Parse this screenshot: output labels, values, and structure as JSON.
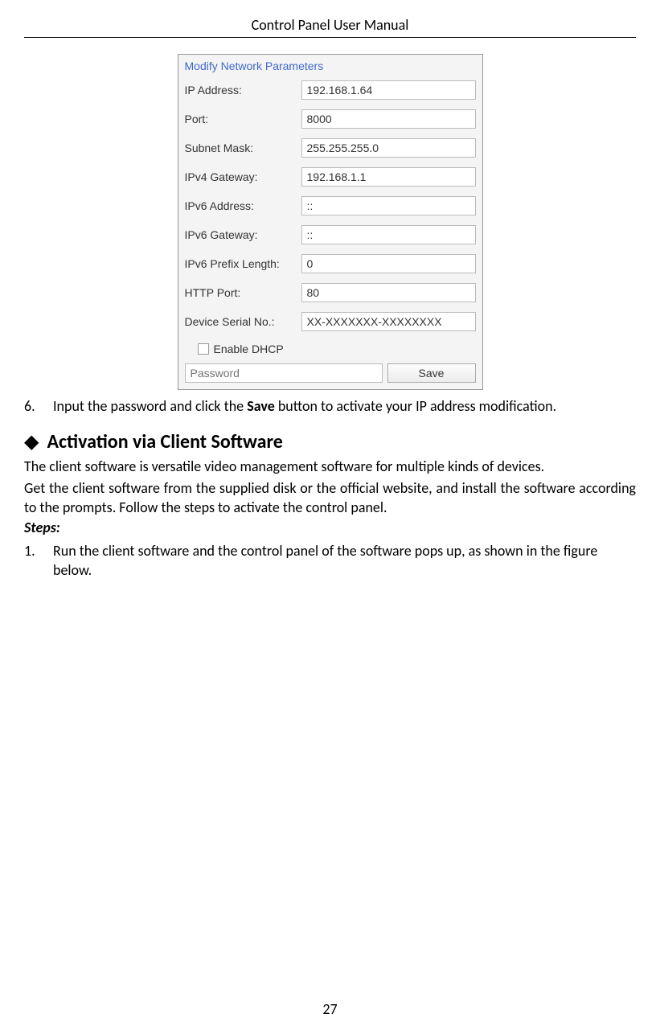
{
  "header": {
    "title": "Control Panel User Manual"
  },
  "network_panel": {
    "title": "Modify Network Parameters",
    "fields": [
      {
        "label": "IP Address:",
        "value": "192.168.1.64"
      },
      {
        "label": "Port:",
        "value": "8000"
      },
      {
        "label": "Subnet Mask:",
        "value": "255.255.255.0"
      },
      {
        "label": "IPv4 Gateway:",
        "value": "192.168.1.1"
      },
      {
        "label": "IPv6 Address:",
        "value": "::"
      },
      {
        "label": "IPv6 Gateway:",
        "value": "::"
      },
      {
        "label": "IPv6 Prefix Length:",
        "value": "0"
      },
      {
        "label": "HTTP Port:",
        "value": "80"
      },
      {
        "label": "Device Serial No.:",
        "value": "XX-XXXXXXX-XXXXXXXX"
      }
    ],
    "dhcp_label": "Enable DHCP",
    "password_placeholder": "Password",
    "save_label": "Save"
  },
  "step6": {
    "num": "6.",
    "text_before": "Input the password and click the ",
    "text_bold": "Save",
    "text_after": " button to activate your IP address modification."
  },
  "section": {
    "title": "Activation via Client Software",
    "para1": "The client software is versatile video management software for multiple kinds of devices.",
    "para2": "Get the client software from the supplied disk or the official website, and install the software according to the prompts. Follow the steps to activate the control panel.",
    "steps_label": "Steps:"
  },
  "step1": {
    "num": "1.",
    "text": "Run the client software and the control panel of the software pops up, as shown in the figure below."
  },
  "page_number": "27"
}
